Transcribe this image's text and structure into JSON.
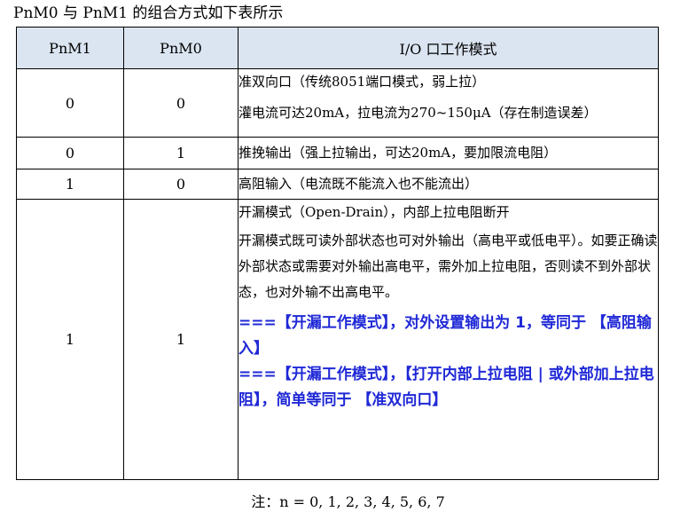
{
  "caption": "PnM0 与 PnM1 的组合方式如下表所示",
  "table": {
    "headers": [
      "PnM1",
      "PnM0",
      "I/O 口工作模式"
    ],
    "rows": [
      {
        "pnm1": "0",
        "pnm0": "0",
        "lines": [
          "准双向口（传统8051端口模式，弱上拉）",
          "灌电流可达20mA，拉电流为270~150μA（存在制造误差）"
        ]
      },
      {
        "pnm1": "0",
        "pnm0": "1",
        "lines": [
          "推挽输出（强上拉输出，可达20mA，要加限流电阻）"
        ]
      },
      {
        "pnm1": "1",
        "pnm0": "0",
        "lines": [
          "高阻输入（电流既不能流入也不能流出）"
        ]
      },
      {
        "pnm1": "1",
        "pnm0": "1",
        "line1": "开漏模式（Open-Drain），内部上拉电阻断开",
        "para": "开漏模式既可读外部状态也可对外输出（高电平或低电平）。如要正确读外部状态或需要对外输出高电平，需外加上拉电阻，否则读不到外部状态，也对外输不出高电平。",
        "note1": "===【开漏工作模式】，对外设置输出为 1，等同于 【高阻输入】",
        "note2": "===【开漏工作模式】，【打开内部上拉电阻 | 或外部加上拉电阻】，简单等同于 【准双向口】"
      }
    ]
  },
  "footnote": "注：n = 0, 1, 2, 3, 4, 5, 6, 7",
  "colors": {
    "header_bg": "#dbe5f1",
    "annotation": "#1f28d6"
  }
}
